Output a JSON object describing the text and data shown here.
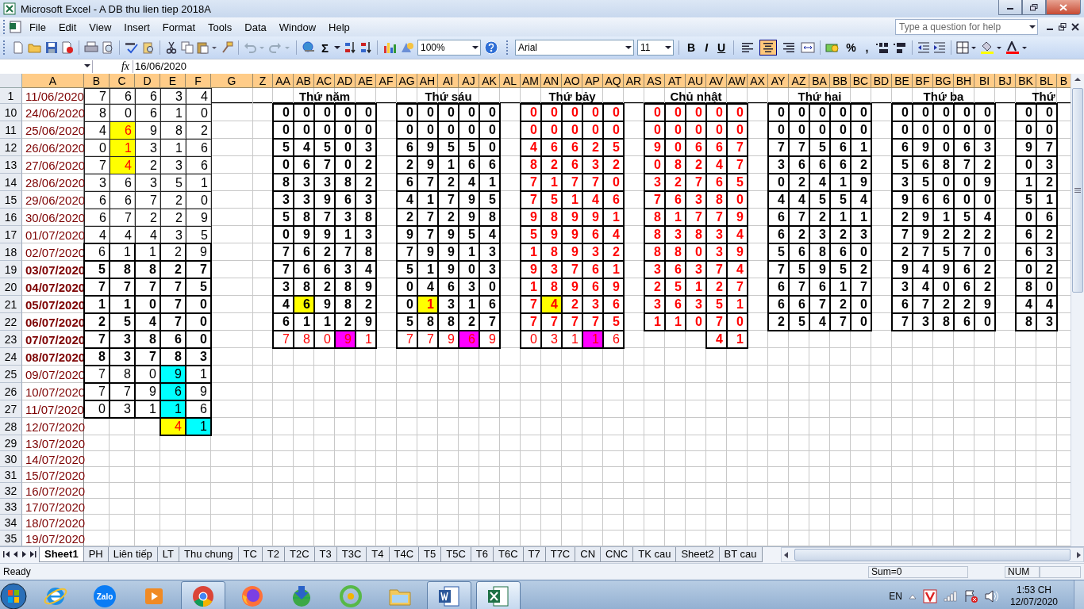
{
  "window": {
    "title": "Microsoft Excel - A DB thu lien tiep 2018A"
  },
  "menu": [
    "File",
    "Edit",
    "View",
    "Insert",
    "Format",
    "Tools",
    "Data",
    "Window",
    "Help"
  ],
  "help_box": {
    "placeholder": "Type a question for help"
  },
  "toolbar": {
    "autosum": "Σ",
    "zoom": "100%",
    "font": "Arial",
    "size": "11",
    "styles": [
      "B",
      "I",
      "U"
    ],
    "align": [
      {
        "selected": false
      },
      {
        "selected": true
      },
      {
        "selected": false
      }
    ],
    "number": [
      "%",
      ","
    ]
  },
  "formula_bar": {
    "function_label": "fx",
    "value": "16/06/2020"
  },
  "columns": [
    "A",
    "B",
    "C",
    "D",
    "E",
    "F",
    "G",
    "Z",
    "AA",
    "AB",
    "AC",
    "AD",
    "AE",
    "AF",
    "AG",
    "AH",
    "AI",
    "AJ",
    "AK",
    "AL",
    "AM",
    "AN",
    "AO",
    "AP",
    "AQ",
    "AR",
    "AS",
    "AT",
    "AU",
    "AV",
    "AW",
    "AX",
    "AY",
    "AZ",
    "BA",
    "BB",
    "BC",
    "BD",
    "BE",
    "BF",
    "BG",
    "BH",
    "BI",
    "BJ",
    "BK",
    "BL",
    "B"
  ],
  "rows": [
    {
      "n": "1",
      "date": "11/06/2020",
      "bold": false,
      "cells": [
        "7",
        "6",
        "6",
        "3",
        "4"
      ]
    },
    {
      "n": "10",
      "date": "24/06/2020",
      "bold": false,
      "cells": [
        "8",
        "0",
        "6",
        "1",
        "0"
      ]
    },
    {
      "n": "11",
      "date": "25/06/2020",
      "bold": false,
      "cells": [
        "4",
        {
          "value": "6",
          "color": "#ffff00",
          "red": true
        },
        "9",
        "8",
        "2"
      ]
    },
    {
      "n": "12",
      "date": "26/06/2020",
      "bold": false,
      "cells": [
        "0",
        {
          "value": "1",
          "color": "#ffff00",
          "red": true
        },
        "3",
        "1",
        "6"
      ]
    },
    {
      "n": "13",
      "date": "27/06/2020",
      "bold": false,
      "cells": [
        "7",
        {
          "value": "4",
          "color": "#ffff00",
          "red": true
        },
        "2",
        "3",
        "6"
      ]
    },
    {
      "n": "14",
      "date": "28/06/2020",
      "bold": false,
      "cells": [
        "3",
        "6",
        "3",
        "5",
        "1"
      ]
    },
    {
      "n": "15",
      "date": "29/06/2020",
      "bold": false,
      "cells": [
        "6",
        "6",
        "7",
        "2",
        "0"
      ]
    },
    {
      "n": "16",
      "date": "30/06/2020",
      "bold": false,
      "cells": [
        "6",
        "7",
        "2",
        "2",
        "9"
      ]
    },
    {
      "n": "17",
      "date": "01/07/2020",
      "bold": false,
      "cells": [
        "4",
        "4",
        "4",
        "3",
        "5"
      ]
    },
    {
      "n": "18",
      "date": "02/07/2020",
      "bold": false,
      "cells": [
        "6",
        "1",
        "1",
        "2",
        "9"
      ]
    },
    {
      "n": "19",
      "date": "03/07/2020",
      "bold": true,
      "cells": [
        "5",
        "8",
        "8",
        "2",
        "7"
      ]
    },
    {
      "n": "20",
      "date": "04/07/2020",
      "bold": true,
      "cells": [
        "7",
        "7",
        "7",
        "7",
        "5"
      ]
    },
    {
      "n": "21",
      "date": "05/07/2020",
      "bold": true,
      "cells": [
        "1",
        "1",
        "0",
        "7",
        "0"
      ]
    },
    {
      "n": "22",
      "date": "06/07/2020",
      "bold": true,
      "cells": [
        "2",
        "5",
        "4",
        "7",
        "0"
      ]
    },
    {
      "n": "23",
      "date": "07/07/2020",
      "bold": true,
      "cells": [
        "7",
        "3",
        "8",
        "6",
        "0"
      ]
    },
    {
      "n": "24",
      "date": "08/07/2020",
      "bold": true,
      "cells": [
        "8",
        "3",
        "7",
        "8",
        "3"
      ]
    },
    {
      "n": "25",
      "date": "09/07/2020",
      "bold": false,
      "cells": [
        "7",
        "8",
        "0",
        {
          "value": "9",
          "color": "#00ffff",
          "red": false
        },
        "1"
      ]
    },
    {
      "n": "26",
      "date": "10/07/2020",
      "bold": false,
      "cells": [
        "7",
        "7",
        "9",
        {
          "value": "6",
          "color": "#00ffff",
          "red": false
        },
        "9"
      ]
    },
    {
      "n": "27",
      "date": "11/07/2020",
      "bold": false,
      "cells": [
        "0",
        "3",
        "1",
        {
          "value": "1",
          "color": "#00ffff",
          "red": false
        },
        "6"
      ]
    },
    {
      "n": "28",
      "date": "12/07/2020",
      "bold": false,
      "cells": [
        "",
        "",
        "",
        {
          "value": "4",
          "color": "#ffff00",
          "red": true
        },
        {
          "value": "1",
          "color": "#00ffff",
          "red": false
        }
      ]
    },
    {
      "n": "29",
      "date": "13/07/2020",
      "bold": false
    },
    {
      "n": "30",
      "date": "14/07/2020",
      "bold": false
    },
    {
      "n": "31",
      "date": "15/07/2020",
      "bold": false
    },
    {
      "n": "32",
      "date": "16/07/2020",
      "bold": false
    },
    {
      "n": "33",
      "date": "17/07/2020",
      "bold": false
    },
    {
      "n": "34",
      "date": "18/07/2020",
      "bold": false
    },
    {
      "n": "35",
      "date": "19/07/2020",
      "bold": false
    }
  ],
  "blocks": [
    {
      "title": "Thứ năm",
      "rows": [
        {
          "bold": true,
          "red": false,
          "cells": [
            "0",
            "0",
            "0",
            "0",
            "0"
          ]
        },
        {
          "bold": true,
          "red": false,
          "cells": [
            "0",
            "0",
            "0",
            "0",
            "0"
          ]
        },
        {
          "bold": true,
          "red": false,
          "cells": [
            "5",
            "4",
            "5",
            "0",
            "3"
          ]
        },
        {
          "bold": true,
          "red": false,
          "cells": [
            "0",
            "6",
            "7",
            "0",
            "2"
          ]
        },
        {
          "bold": true,
          "red": false,
          "cells": [
            "8",
            "3",
            "3",
            "8",
            "2"
          ]
        },
        {
          "bold": true,
          "red": false,
          "cells": [
            "3",
            "3",
            "9",
            "6",
            "3"
          ]
        },
        {
          "bold": true,
          "red": false,
          "cells": [
            "5",
            "8",
            "7",
            "3",
            "8"
          ]
        },
        {
          "bold": true,
          "red": false,
          "cells": [
            "0",
            "9",
            "9",
            "1",
            "3"
          ]
        },
        {
          "bold": true,
          "red": false,
          "cells": [
            "7",
            "6",
            "2",
            "7",
            "8"
          ]
        },
        {
          "bold": true,
          "red": false,
          "cells": [
            "7",
            "6",
            "6",
            "3",
            "4"
          ]
        },
        {
          "bold": true,
          "red": false,
          "cells": [
            "3",
            "8",
            "2",
            "8",
            "9"
          ]
        },
        {
          "bold": true,
          "red": false,
          "cells": [
            "4",
            {
              "value": "6",
              "color": "#ffff00",
              "red": false
            },
            "9",
            "8",
            "2"
          ]
        },
        {
          "bold": true,
          "red": false,
          "cells": [
            "6",
            "1",
            "1",
            "2",
            "9"
          ]
        },
        {
          "bold": false,
          "red": true,
          "cells": [
            "7",
            "8",
            "0",
            {
              "value": "9",
              "color": "#ff00ff"
            },
            "1"
          ]
        }
      ]
    },
    {
      "title": "Thứ sáu",
      "rows": [
        {
          "bold": true,
          "red": false,
          "cells": [
            "0",
            "0",
            "0",
            "0",
            "0"
          ]
        },
        {
          "bold": true,
          "red": false,
          "cells": [
            "0",
            "0",
            "0",
            "0",
            "0"
          ]
        },
        {
          "bold": true,
          "red": false,
          "cells": [
            "6",
            "9",
            "5",
            "5",
            "0"
          ]
        },
        {
          "bold": true,
          "red": false,
          "cells": [
            "2",
            "9",
            "1",
            "6",
            "6"
          ]
        },
        {
          "bold": true,
          "red": false,
          "cells": [
            "6",
            "7",
            "2",
            "4",
            "1"
          ]
        },
        {
          "bold": true,
          "red": false,
          "cells": [
            "4",
            "1",
            "7",
            "9",
            "5"
          ]
        },
        {
          "bold": true,
          "red": false,
          "cells": [
            "2",
            "7",
            "2",
            "9",
            "8"
          ]
        },
        {
          "bold": true,
          "red": false,
          "cells": [
            "9",
            "7",
            "9",
            "5",
            "4"
          ]
        },
        {
          "bold": true,
          "red": false,
          "cells": [
            "7",
            "9",
            "9",
            "1",
            "3"
          ]
        },
        {
          "bold": true,
          "red": false,
          "cells": [
            "5",
            "1",
            "9",
            "0",
            "3"
          ]
        },
        {
          "bold": true,
          "red": false,
          "cells": [
            "0",
            "4",
            "6",
            "3",
            "0"
          ]
        },
        {
          "bold": true,
          "red": false,
          "cells": [
            "0",
            {
              "value": "1",
              "color": "#ffff00",
              "red": true
            },
            "3",
            "1",
            "6"
          ]
        },
        {
          "bold": true,
          "red": false,
          "cells": [
            "5",
            "8",
            "8",
            "2",
            "7"
          ]
        },
        {
          "bold": false,
          "red": true,
          "cells": [
            "7",
            "7",
            "9",
            {
              "value": "6",
              "color": "#ff00ff"
            },
            "9"
          ]
        }
      ]
    },
    {
      "title": "Thứ bảy",
      "rows": [
        {
          "bold": true,
          "red": true,
          "cells": [
            "0",
            "0",
            "0",
            "0",
            "0"
          ]
        },
        {
          "bold": true,
          "red": true,
          "cells": [
            "0",
            "0",
            "0",
            "0",
            "0"
          ]
        },
        {
          "bold": true,
          "red": true,
          "cells": [
            "4",
            "6",
            "6",
            "2",
            "5"
          ]
        },
        {
          "bold": true,
          "red": true,
          "cells": [
            "8",
            "2",
            "6",
            "3",
            "2"
          ]
        },
        {
          "bold": true,
          "red": true,
          "cells": [
            "7",
            "1",
            "7",
            "7",
            "0"
          ]
        },
        {
          "bold": true,
          "red": true,
          "cells": [
            "7",
            "5",
            "1",
            "4",
            "6"
          ]
        },
        {
          "bold": true,
          "red": true,
          "cells": [
            "9",
            "8",
            "9",
            "9",
            "1"
          ]
        },
        {
          "bold": true,
          "red": true,
          "cells": [
            "5",
            "9",
            "9",
            "6",
            "4"
          ]
        },
        {
          "bold": true,
          "red": true,
          "cells": [
            "1",
            "8",
            "9",
            "3",
            "2"
          ]
        },
        {
          "bold": true,
          "red": true,
          "cells": [
            "9",
            "3",
            "7",
            "6",
            "1"
          ]
        },
        {
          "bold": true,
          "red": true,
          "cells": [
            "1",
            "8",
            "9",
            "6",
            "9"
          ]
        },
        {
          "bold": true,
          "red": true,
          "cells": [
            "7",
            {
              "value": "4",
              "color": "#ffff00"
            },
            "2",
            "3",
            "6"
          ]
        },
        {
          "bold": true,
          "red": true,
          "cells": [
            "7",
            "7",
            "7",
            "7",
            "5"
          ]
        },
        {
          "bold": false,
          "red": true,
          "cells": [
            "0",
            "3",
            "1",
            {
              "value": "1",
              "color": "#ff00ff"
            },
            "6"
          ]
        }
      ]
    },
    {
      "title": "Chủ nhật",
      "rows": [
        {
          "bold": true,
          "red": true,
          "cells": [
            "0",
            "0",
            "0",
            "0",
            "0"
          ]
        },
        {
          "bold": true,
          "red": true,
          "cells": [
            "0",
            "0",
            "0",
            "0",
            "0"
          ]
        },
        {
          "bold": true,
          "red": true,
          "cells": [
            "9",
            "0",
            "6",
            "6",
            "7"
          ]
        },
        {
          "bold": true,
          "red": true,
          "cells": [
            "0",
            "8",
            "2",
            "4",
            "7"
          ]
        },
        {
          "bold": true,
          "red": true,
          "cells": [
            "3",
            "2",
            "7",
            "6",
            "5"
          ]
        },
        {
          "bold": true,
          "red": true,
          "cells": [
            "7",
            "6",
            "3",
            "8",
            "0"
          ]
        },
        {
          "bold": true,
          "red": true,
          "cells": [
            "8",
            "1",
            "7",
            "7",
            "9"
          ]
        },
        {
          "bold": true,
          "red": true,
          "cells": [
            "8",
            "3",
            "8",
            "3",
            "4"
          ]
        },
        {
          "bold": true,
          "red": true,
          "cells": [
            "8",
            "8",
            "0",
            "3",
            "9"
          ]
        },
        {
          "bold": true,
          "red": true,
          "cells": [
            "3",
            "6",
            "3",
            "7",
            "4"
          ]
        },
        {
          "bold": true,
          "red": true,
          "cells": [
            "2",
            "5",
            "1",
            "2",
            "7"
          ]
        },
        {
          "bold": true,
          "red": true,
          "cells": [
            "3",
            "6",
            "3",
            "5",
            "1"
          ]
        },
        {
          "bold": true,
          "red": true,
          "cells": [
            "1",
            "1",
            "0",
            "7",
            "0"
          ]
        },
        {
          "bold": true,
          "red": true,
          "cells": [
            "",
            "",
            "",
            "4",
            "1"
          ]
        }
      ]
    },
    {
      "title": "Thứ hai",
      "rows": [
        {
          "bold": true,
          "red": false,
          "cells": [
            "0",
            "0",
            "0",
            "0",
            "0"
          ]
        },
        {
          "bold": true,
          "red": false,
          "cells": [
            "0",
            "0",
            "0",
            "0",
            "0"
          ]
        },
        {
          "bold": true,
          "red": false,
          "cells": [
            "7",
            "7",
            "5",
            "6",
            "1"
          ]
        },
        {
          "bold": true,
          "red": false,
          "cells": [
            "3",
            "6",
            "6",
            "6",
            "2"
          ]
        },
        {
          "bold": true,
          "red": false,
          "cells": [
            "0",
            "2",
            "4",
            "1",
            "9"
          ]
        },
        {
          "bold": true,
          "red": false,
          "cells": [
            "4",
            "4",
            "5",
            "5",
            "4"
          ]
        },
        {
          "bold": true,
          "red": false,
          "cells": [
            "6",
            "7",
            "2",
            "1",
            "1"
          ]
        },
        {
          "bold": true,
          "red": false,
          "cells": [
            "6",
            "2",
            "3",
            "2",
            "3"
          ]
        },
        {
          "bold": true,
          "red": false,
          "cells": [
            "5",
            "6",
            "8",
            "6",
            "0"
          ]
        },
        {
          "bold": true,
          "red": false,
          "cells": [
            "7",
            "5",
            "9",
            "5",
            "2"
          ]
        },
        {
          "bold": true,
          "red": false,
          "cells": [
            "6",
            "7",
            "6",
            "1",
            "7"
          ]
        },
        {
          "bold": true,
          "red": false,
          "cells": [
            "6",
            "6",
            "7",
            "2",
            "0"
          ]
        },
        {
          "bold": true,
          "red": false,
          "cells": [
            "2",
            "5",
            "4",
            "7",
            "0"
          ]
        }
      ]
    },
    {
      "title": "Thứ ba",
      "rows": [
        {
          "bold": true,
          "red": false,
          "cells": [
            "0",
            "0",
            "0",
            "0",
            "0"
          ]
        },
        {
          "bold": true,
          "red": false,
          "cells": [
            "0",
            "0",
            "0",
            "0",
            "0"
          ]
        },
        {
          "bold": true,
          "red": false,
          "cells": [
            "6",
            "9",
            "0",
            "6",
            "3"
          ]
        },
        {
          "bold": true,
          "red": false,
          "cells": [
            "5",
            "6",
            "8",
            "7",
            "2"
          ]
        },
        {
          "bold": true,
          "red": false,
          "cells": [
            "3",
            "5",
            "0",
            "0",
            "9"
          ]
        },
        {
          "bold": true,
          "red": false,
          "cells": [
            "9",
            "6",
            "6",
            "0",
            "0"
          ]
        },
        {
          "bold": true,
          "red": false,
          "cells": [
            "2",
            "9",
            "1",
            "5",
            "4"
          ]
        },
        {
          "bold": true,
          "red": false,
          "cells": [
            "7",
            "9",
            "2",
            "2",
            "2"
          ]
        },
        {
          "bold": true,
          "red": false,
          "cells": [
            "2",
            "7",
            "5",
            "7",
            "0"
          ]
        },
        {
          "bold": true,
          "red": false,
          "cells": [
            "9",
            "4",
            "9",
            "6",
            "2"
          ]
        },
        {
          "bold": true,
          "red": false,
          "cells": [
            "3",
            "4",
            "0",
            "6",
            "2"
          ]
        },
        {
          "bold": true,
          "red": false,
          "cells": [
            "6",
            "7",
            "2",
            "2",
            "9"
          ]
        },
        {
          "bold": true,
          "red": false,
          "cells": [
            "7",
            "3",
            "8",
            "6",
            "0"
          ]
        }
      ]
    },
    {
      "title": "Thứ",
      "rows": [
        {
          "bold": true,
          "red": false,
          "cells": [
            "0",
            "0"
          ]
        },
        {
          "bold": true,
          "red": false,
          "cells": [
            "0",
            "0"
          ]
        },
        {
          "bold": true,
          "red": false,
          "cells": [
            "9",
            "7"
          ]
        },
        {
          "bold": true,
          "red": false,
          "cells": [
            "0",
            "3"
          ]
        },
        {
          "bold": true,
          "red": false,
          "cells": [
            "1",
            "2"
          ]
        },
        {
          "bold": true,
          "red": false,
          "cells": [
            "5",
            "1"
          ]
        },
        {
          "bold": true,
          "red": false,
          "cells": [
            "0",
            "6"
          ]
        },
        {
          "bold": true,
          "red": false,
          "cells": [
            "6",
            "2"
          ]
        },
        {
          "bold": true,
          "red": false,
          "cells": [
            "6",
            "3"
          ]
        },
        {
          "bold": true,
          "red": false,
          "cells": [
            "0",
            "2"
          ]
        },
        {
          "bold": true,
          "red": false,
          "cells": [
            "8",
            "0"
          ]
        },
        {
          "bold": true,
          "red": false,
          "cells": [
            "4",
            "4"
          ]
        },
        {
          "bold": true,
          "red": false,
          "cells": [
            "8",
            "3"
          ]
        }
      ]
    }
  ],
  "sheet_tabs": [
    {
      "label": "Sheet1",
      "selected": true
    },
    {
      "label": "PH",
      "selected": false
    },
    {
      "label": "Liên tiếp",
      "selected": false
    },
    {
      "label": "LT",
      "selected": false
    },
    {
      "label": "Thu chung",
      "selected": false
    },
    {
      "label": "TC",
      "selected": false
    },
    {
      "label": "T2",
      "selected": false
    },
    {
      "label": "T2C",
      "selected": false
    },
    {
      "label": "T3",
      "selected": false
    },
    {
      "label": "T3C",
      "selected": false
    },
    {
      "label": "T4",
      "selected": false
    },
    {
      "label": "T4C",
      "selected": false
    },
    {
      "label": "T5",
      "selected": false
    },
    {
      "label": "T5C",
      "selected": false
    },
    {
      "label": "T6",
      "selected": false
    },
    {
      "label": "T6C",
      "selected": false
    },
    {
      "label": "T7",
      "selected": false
    },
    {
      "label": "T7C",
      "selected": false
    },
    {
      "label": "CN",
      "selected": false
    },
    {
      "label": "CNC",
      "selected": false
    },
    {
      "label": "TK cau",
      "selected": false
    },
    {
      "label": "Sheet2",
      "selected": false
    },
    {
      "label": "BT cau",
      "selected": false
    }
  ],
  "status_bar": {
    "mode": "Ready",
    "sum": "Sum=0",
    "num": "NUM"
  },
  "taskbar": {
    "apps": [
      {
        "kind": "ie",
        "running": false,
        "selected": false
      },
      {
        "kind": "zalo",
        "label": "Zalo",
        "running": false,
        "selected": false
      },
      {
        "kind": "media",
        "running": false,
        "selected": false
      },
      {
        "kind": "chrome",
        "running": true,
        "selected": false
      },
      {
        "kind": "firefox",
        "running": false,
        "selected": false
      },
      {
        "kind": "download",
        "running": false,
        "selected": false
      },
      {
        "kind": "coccoc",
        "running": false,
        "selected": false
      },
      {
        "kind": "folder",
        "running": false,
        "selected": false
      },
      {
        "kind": "word",
        "running": true,
        "selected": false
      },
      {
        "kind": "excel",
        "running": true,
        "selected": true
      }
    ],
    "language": "EN",
    "time": "1:53 CH",
    "date": "12/07/2020"
  }
}
